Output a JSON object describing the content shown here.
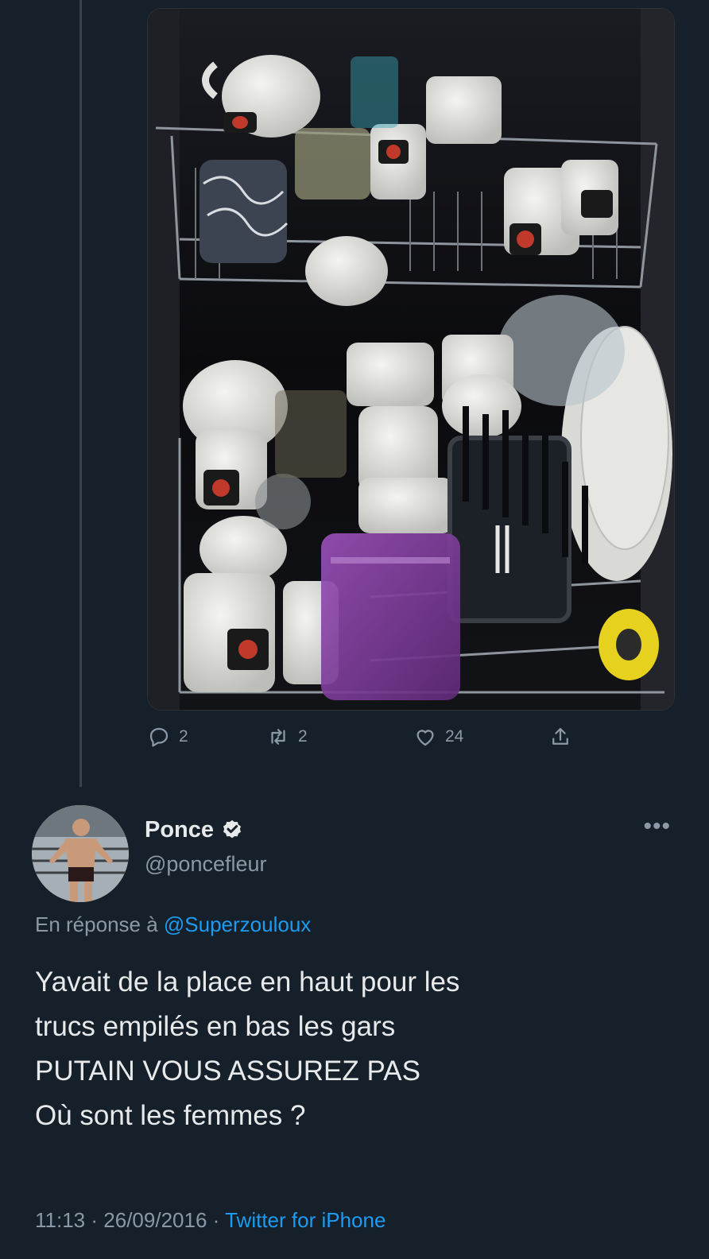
{
  "thread": {
    "parent_tweet": {
      "media": {
        "image_description": "dishwasher-photo"
      },
      "actions": {
        "reply_count": "2",
        "retweet_count": "2",
        "like_count": "24"
      }
    }
  },
  "reply_tweet": {
    "author": {
      "display_name": "Ponce",
      "handle": "@poncefleur",
      "verified": true
    },
    "more_label": "•••",
    "reply_prefix": "En réponse à",
    "reply_mention": "@Superzouloux",
    "text_lines": [
      "Yavait de la place en haut pour les",
      "trucs empilés en bas les gars",
      "PUTAIN VOUS ASSUREZ PAS",
      "Où sont les femmes ?"
    ],
    "time": "11:13",
    "date": "26/09/2016",
    "separator": "·",
    "source": "Twitter for iPhone"
  },
  "colors": {
    "background": "#15202b",
    "primary_text": "#e7e9ea",
    "secondary_text": "#8b98a5",
    "accent": "#1d9bf0"
  }
}
